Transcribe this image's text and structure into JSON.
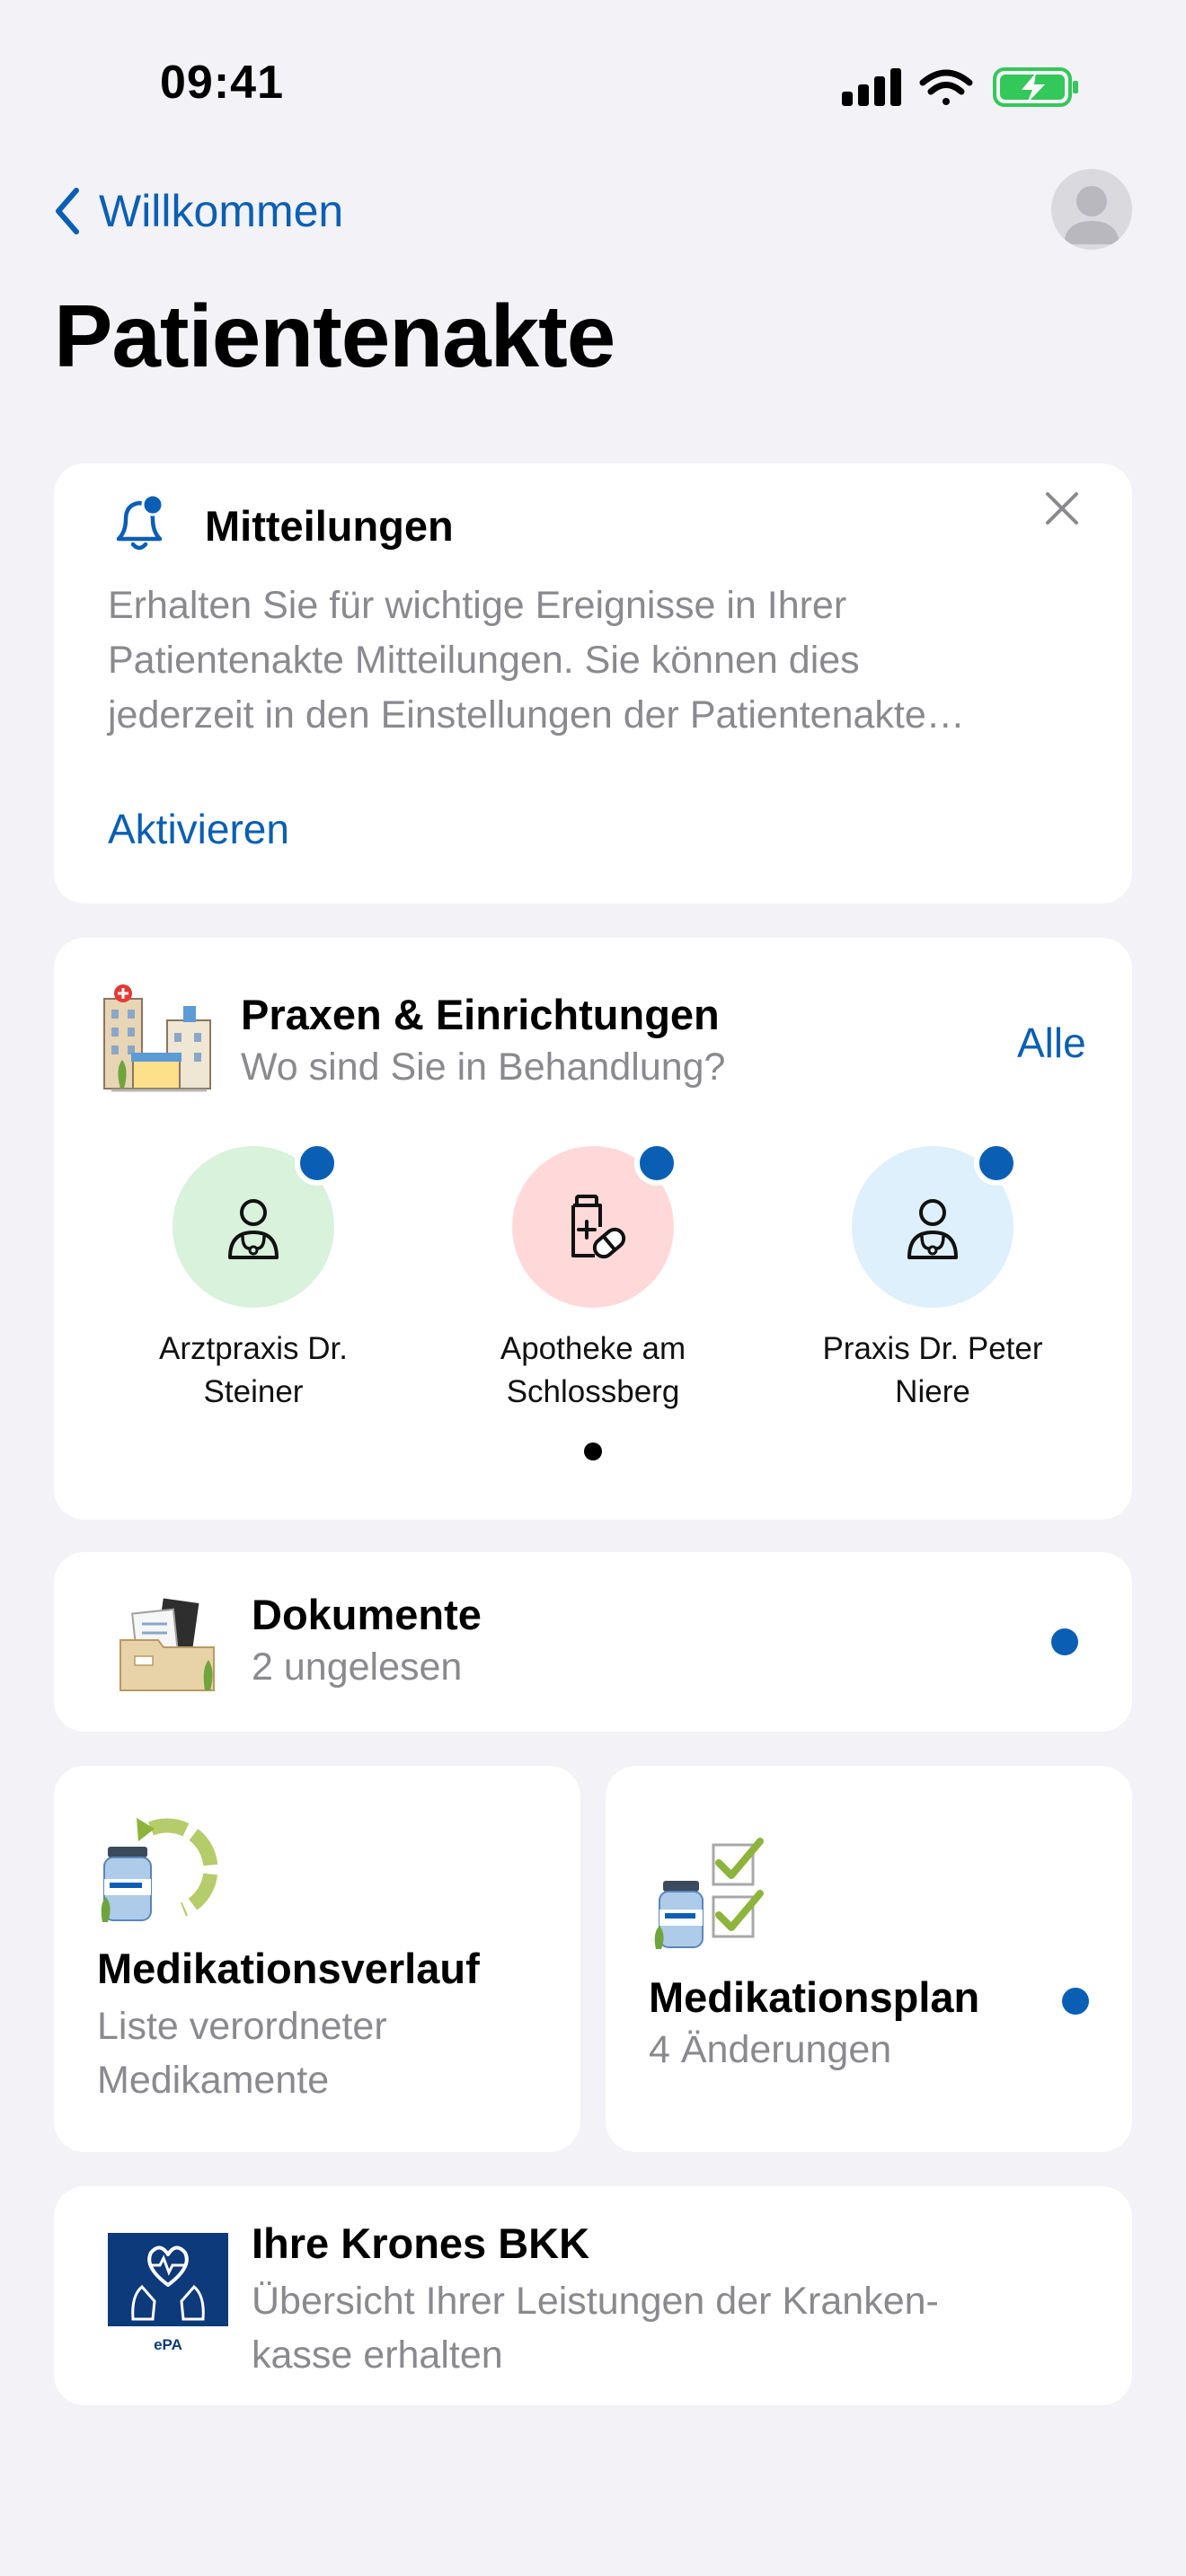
{
  "status": {
    "time": "09:41"
  },
  "nav": {
    "back_label": "Willkommen"
  },
  "page": {
    "title": "Patientenakte"
  },
  "notifications": {
    "title": "Mitteilungen",
    "body_lines": [
      "Erhalten Sie für wichtige Ereignisse in Ihrer",
      "Patientenakte Mitteilungen. Sie können dies",
      "jederzeit in den Einstellungen der Patientenakte…"
    ],
    "action": "Aktivieren"
  },
  "practices": {
    "title": "Praxen & Einrichtungen",
    "subtitle": "Wo sind Sie in Behandlung?",
    "all_label": "Alle",
    "items": [
      {
        "name_line1": "Arztpraxis Dr.",
        "name_line2": "Steiner",
        "color": "#D8F2DC",
        "icon": "doctor-icon"
      },
      {
        "name_line1": "Apotheke am",
        "name_line2": "Schlossberg",
        "color": "#FFD9D9",
        "icon": "pharmacy-icon"
      },
      {
        "name_line1": "Praxis Dr. Peter",
        "name_line2": "Niere",
        "color": "#DDF0FB",
        "icon": "doctor-icon"
      }
    ]
  },
  "documents": {
    "title": "Dokumente",
    "subtitle": "2 ungelesen"
  },
  "medication_history": {
    "title": "Medikationsverlauf",
    "subtitle_line1": "Liste verordneter",
    "subtitle_line2": "Medikamente"
  },
  "medication_plan": {
    "title": "Medikationsplan",
    "subtitle": "4 Änderungen"
  },
  "insurance": {
    "title": "Ihre Krones BKK",
    "subtitle_line1": "Übersicht Ihrer Leistungen der Kranken-",
    "subtitle_line2": "kasse erhalten",
    "logo_text": "ePA"
  },
  "colors": {
    "accent": "#0A5FB4",
    "background": "#F2F2F7",
    "battery": "#34C759"
  }
}
